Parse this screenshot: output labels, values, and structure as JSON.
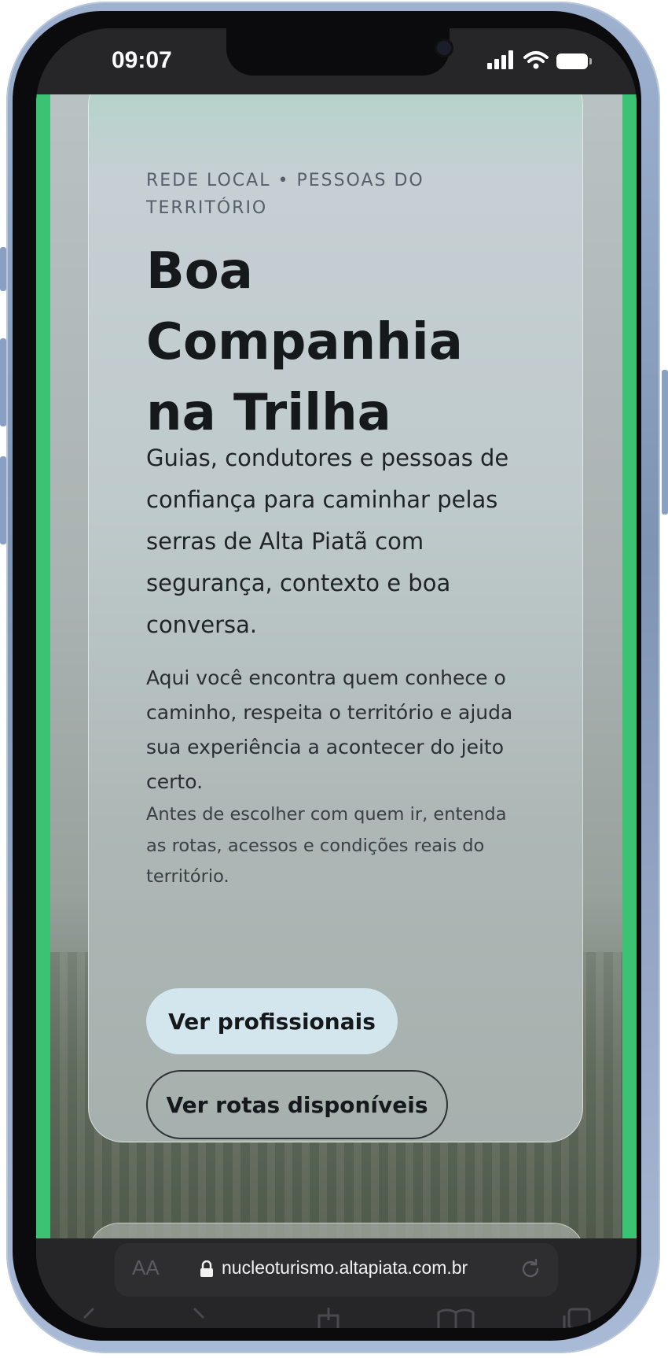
{
  "status_bar": {
    "time": "09:07"
  },
  "hero": {
    "eyebrow": "REDE LOCAL • PESSOAS DO TERRITÓRIO",
    "title": "Boa Companhia na Trilha",
    "lead": "Guias, condutores e pessoas de confiança para caminhar pelas serras de Alta Piatã com segurança, contexto e boa conversa.",
    "body1": "Aqui você encontra quem conhece o caminho, respeita o território e ajuda sua experiência a acontecer do jeito certo.",
    "body2": "Antes de escolher com quem ir, entenda as rotas, acessos e condições reais do território.",
    "primary_button": "Ver profissionais",
    "secondary_button": "Ver rotas disponíveis"
  },
  "browser": {
    "text_size_label": "AA",
    "url": "nucleoturismo.altapiata.com.br"
  },
  "colors": {
    "accent_green": "#3cc273",
    "primary_button_bg": "#d3e6ee",
    "text_dark": "#16191b"
  },
  "icons": {
    "signal": "signal-icon",
    "wifi": "wifi-icon",
    "battery": "battery-icon",
    "lock": "lock-icon",
    "reload": "reload-icon",
    "back": "back-icon",
    "forward": "forward-icon",
    "share": "share-icon",
    "bookmarks": "bookmarks-icon",
    "tabs": "tabs-icon"
  }
}
